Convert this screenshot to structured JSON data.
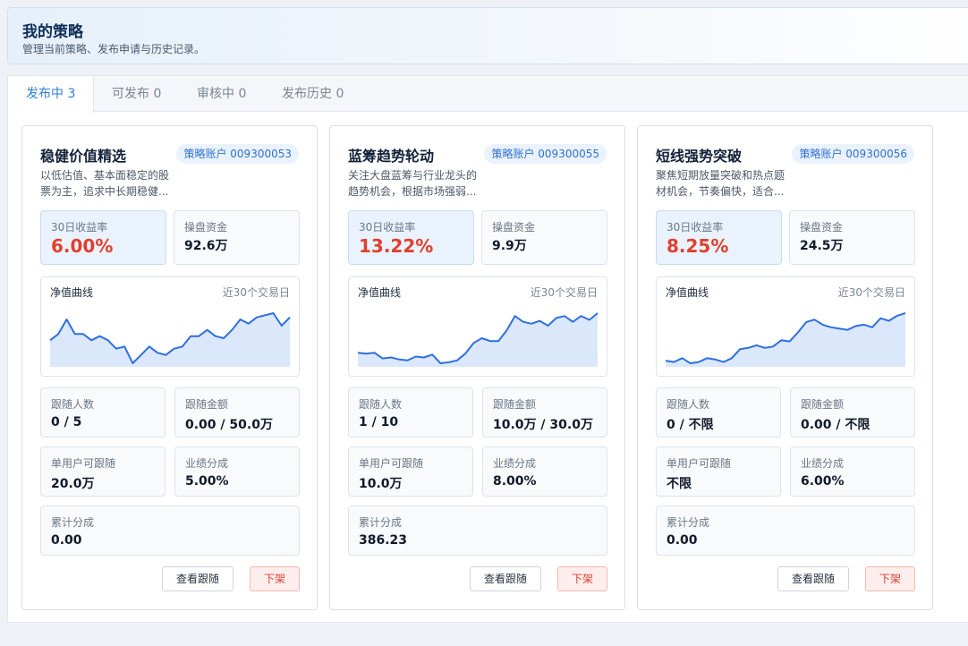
{
  "header": {
    "title": "我的策略",
    "subtitle": "管理当前策略、发布申请与历史记录。"
  },
  "tabs": [
    {
      "label": "发布中 3",
      "active": true
    },
    {
      "label": "可发布 0",
      "active": false
    },
    {
      "label": "审核中 0",
      "active": false
    },
    {
      "label": "发布历史 0",
      "active": false
    }
  ],
  "labels": {
    "return_30d": "30日收益率",
    "capital": "操盘资金",
    "chart_title": "净值曲线",
    "chart_range": "近30个交易日",
    "followers": "跟随人数",
    "follow_amount": "跟随金额",
    "per_user": "单用户可跟随",
    "perf_share": "业绩分成",
    "cum_share": "累计分成",
    "view_btn": "查看跟随",
    "delist_btn": "下架"
  },
  "colors": {
    "accent": "#2f7fd8",
    "positive_return": "#e0402f",
    "chart_line": "#2f6fe0",
    "chart_fill": "#dbe8fb"
  },
  "strategies": [
    {
      "name": "稳健价值精选",
      "account": "策略账户 009300053",
      "desc": "以低估值、基本面稳定的股票为主，追求中长期稳健...",
      "return_30d": "6.00%",
      "capital": "92.6万",
      "followers": "0 / 5",
      "follow_amount": "0.00 / 50.0万",
      "per_user": "20.0万",
      "perf_share": "5.00%",
      "cum_share": "0.00",
      "chart_data": {
        "type": "area",
        "values": [
          1.01,
          1.013,
          1.02,
          1.013,
          1.013,
          1.01,
          1.012,
          1.01,
          1.006,
          1.007,
          0.999,
          1.003,
          1.007,
          1.004,
          1.003,
          1.006,
          1.007,
          1.012,
          1.012,
          1.015,
          1.012,
          1.011,
          1.015,
          1.02,
          1.018,
          1.021,
          1.022,
          1.023,
          1.017,
          1.021
        ]
      }
    },
    {
      "name": "蓝筹趋势轮动",
      "account": "策略账户 009300055",
      "desc": "关注大盘蓝筹与行业龙头的趋势机会，根据市场强弱...",
      "return_30d": "13.22%",
      "capital": "9.9万",
      "followers": "1 / 10",
      "follow_amount": "10.0万 / 30.0万",
      "per_user": "10.0万",
      "perf_share": "8.00%",
      "cum_share": "386.23",
      "chart_data": {
        "type": "area",
        "values": [
          1.011,
          1.01,
          1.011,
          1.005,
          1.006,
          1.004,
          1.003,
          1.007,
          1.006,
          1.009,
          1.0,
          1.001,
          1.003,
          1.01,
          1.021,
          1.026,
          1.023,
          1.023,
          1.034,
          1.049,
          1.043,
          1.041,
          1.044,
          1.039,
          1.047,
          1.049,
          1.043,
          1.049,
          1.045,
          1.052
        ]
      }
    },
    {
      "name": "短线强势突破",
      "account": "策略账户 009300056",
      "desc": "聚焦短期放量突破和热点题材机会，节奏偏快，适合...",
      "return_30d": "8.25%",
      "capital": "24.5万",
      "followers": "0 / 不限",
      "follow_amount": "0.00 / 不限",
      "per_user": "不限",
      "perf_share": "6.00%",
      "cum_share": "0.00",
      "chart_data": {
        "type": "area",
        "values": [
          1.005,
          1.004,
          1.007,
          1.003,
          1.004,
          1.007,
          1.006,
          1.004,
          1.007,
          1.014,
          1.015,
          1.017,
          1.015,
          1.016,
          1.021,
          1.02,
          1.027,
          1.035,
          1.037,
          1.033,
          1.031,
          1.03,
          1.029,
          1.032,
          1.033,
          1.031,
          1.038,
          1.036,
          1.04,
          1.042
        ]
      }
    }
  ]
}
